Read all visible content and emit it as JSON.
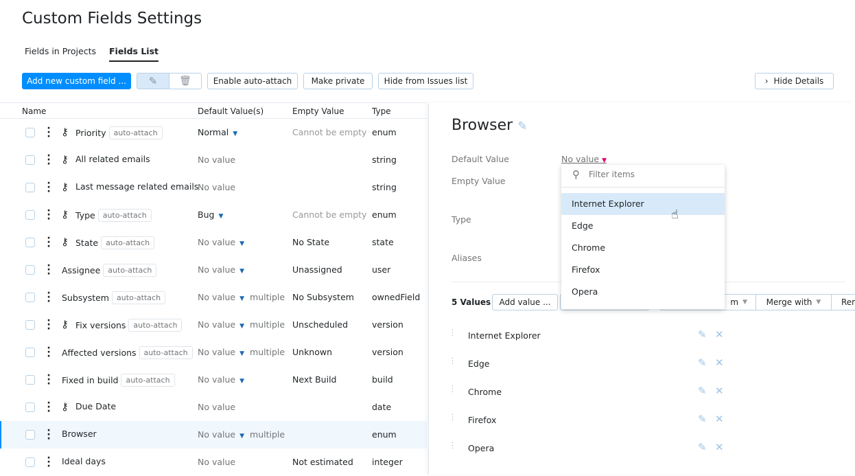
{
  "title": "Custom Fields Settings",
  "tabs": [
    {
      "label": "Fields in Projects"
    },
    {
      "label": "Fields List"
    }
  ],
  "toolbar": {
    "add": "Add new custom field ...",
    "auto_attach": "Enable auto-attach",
    "private": "Make private",
    "hide": "Hide from Issues list",
    "hide_details": "Hide Details"
  },
  "columns": {
    "name": "Name",
    "default": "Default Value(s)",
    "empty": "Empty Value",
    "type": "Type"
  },
  "rows": [
    {
      "name": "Priority",
      "badge": "auto-attach",
      "default": "Normal",
      "caret": true,
      "multiple": "",
      "empty": "Cannot be empty",
      "type": "enum",
      "key": true
    },
    {
      "name": "All related emails",
      "badge": "",
      "default": "No value",
      "multiple": "",
      "empty": "",
      "type": "string",
      "key": true
    },
    {
      "name": "Last message related emails",
      "badge": "",
      "default": "No value",
      "multiple": "",
      "empty": "",
      "type": "string",
      "key": true
    },
    {
      "name": "Type",
      "badge": "auto-attach",
      "default": "Bug",
      "caret": true,
      "multiple": "",
      "empty": "Cannot be empty",
      "type": "enum",
      "key": true
    },
    {
      "name": "State",
      "badge": "auto-attach",
      "default": "No value",
      "caret": true,
      "multiple": "",
      "empty": "No State",
      "type": "state",
      "key": true
    },
    {
      "name": "Assignee",
      "badge": "auto-attach",
      "default": "No value",
      "caret": true,
      "multiple": "",
      "empty": "Unassigned",
      "type": "user",
      "key": false
    },
    {
      "name": "Subsystem",
      "badge": "auto-attach",
      "default": "No value",
      "caret": true,
      "multiple": "multiple",
      "empty": "No Subsystem",
      "type": "ownedField",
      "key": false
    },
    {
      "name": "Fix versions",
      "badge": "auto-attach",
      "default": "No value",
      "caret": true,
      "multiple": "multiple",
      "empty": "Unscheduled",
      "type": "version",
      "key": true
    },
    {
      "name": "Affected versions",
      "badge": "auto-attach",
      "default": "No value",
      "caret": true,
      "multiple": "multiple",
      "empty": "Unknown",
      "type": "version",
      "key": false
    },
    {
      "name": "Fixed in build",
      "badge": "auto-attach",
      "default": "No value",
      "caret": true,
      "multiple": "",
      "empty": "Next Build",
      "type": "build",
      "key": false
    },
    {
      "name": "Due Date",
      "badge": "",
      "default": "No value",
      "multiple": "",
      "empty": "",
      "type": "date",
      "key": true
    },
    {
      "name": "Browser",
      "badge": "",
      "default": "No value",
      "caret": true,
      "multiple": "multiple",
      "empty": "",
      "type": "enum",
      "key": false,
      "selected": true
    },
    {
      "name": "Ideal days",
      "badge": "",
      "default": "No value",
      "multiple": "",
      "empty": "Not estimated",
      "type": "integer",
      "key": false
    }
  ],
  "details": {
    "title": "Browser",
    "labels": {
      "default": "Default Value",
      "empty": "Empty Value",
      "type": "Type",
      "aliases": "Aliases"
    },
    "default_value": "No value",
    "count": "5 Values",
    "add_value": "Add value ...",
    "hidden_btn": "m",
    "merge": "Merge with",
    "remove": "Rem",
    "values": [
      "Internet Explorer",
      "Edge",
      "Chrome",
      "Firefox",
      "Opera"
    ]
  },
  "dropdown": {
    "placeholder": "Filter items",
    "items": [
      "Internet Explorer",
      "Edge",
      "Chrome",
      "Firefox",
      "Opera"
    ],
    "highlighted": 0
  },
  "colors": {
    "accent": "#008eff",
    "link": "#1a69b1"
  }
}
